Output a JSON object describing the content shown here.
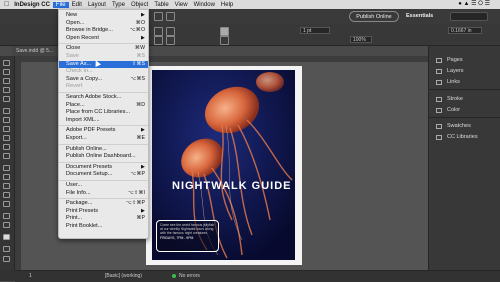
{
  "menubar": {
    "apple": "",
    "app": "InDesign CC",
    "items": [
      "File",
      "Edit",
      "Layout",
      "Type",
      "Object",
      "Table",
      "View",
      "Window",
      "Help"
    ],
    "right_icons": "● ▲ ☰ ⭘ ☰"
  },
  "toolbar": {
    "publish_label": "Publish Online",
    "workspace": "Essentials",
    "stroke_weight": "1 pt",
    "zoom": "100%",
    "dimension": "0.1667 in"
  },
  "document": {
    "tab_title": "Save.indd @ 5..."
  },
  "file_menu": {
    "items": [
      {
        "label": "New",
        "shortcut": "▶",
        "state": "normal"
      },
      {
        "label": "Open...",
        "shortcut": "⌘O",
        "state": "normal"
      },
      {
        "label": "Browse in Bridge...",
        "shortcut": "⌥⌘O",
        "state": "normal"
      },
      {
        "label": "Open Recent",
        "shortcut": "▶",
        "state": "normal"
      },
      {
        "sep": true
      },
      {
        "label": "Close",
        "shortcut": "⌘W",
        "state": "normal"
      },
      {
        "label": "Save",
        "shortcut": "⌘S",
        "state": "disabled"
      },
      {
        "label": "Save As...",
        "shortcut": "⇧⌘S",
        "state": "highlighted"
      },
      {
        "label": "Check In...",
        "shortcut": "",
        "state": "disabled"
      },
      {
        "label": "Save a Copy...",
        "shortcut": "⌥⌘S",
        "state": "normal"
      },
      {
        "label": "Revert",
        "shortcut": "",
        "state": "disabled"
      },
      {
        "sep": true
      },
      {
        "label": "Search Adobe Stock...",
        "shortcut": "",
        "state": "normal"
      },
      {
        "label": "Place...",
        "shortcut": "⌘D",
        "state": "normal"
      },
      {
        "label": "Place from CC Libraries...",
        "shortcut": "",
        "state": "normal"
      },
      {
        "label": "Import XML...",
        "shortcut": "",
        "state": "normal"
      },
      {
        "sep": true
      },
      {
        "label": "Adobe PDF Presets",
        "shortcut": "▶",
        "state": "normal"
      },
      {
        "label": "Export...",
        "shortcut": "⌘E",
        "state": "normal"
      },
      {
        "sep": true
      },
      {
        "label": "Publish Online...",
        "shortcut": "",
        "state": "normal"
      },
      {
        "label": "Publish Online Dashboard...",
        "shortcut": "",
        "state": "normal"
      },
      {
        "sep": true
      },
      {
        "label": "Document Presets",
        "shortcut": "▶",
        "state": "normal"
      },
      {
        "label": "Document Setup...",
        "shortcut": "⌥⌘P",
        "state": "normal"
      },
      {
        "sep": true
      },
      {
        "label": "User...",
        "shortcut": "",
        "state": "normal"
      },
      {
        "label": "File Info...",
        "shortcut": "⌥⇧⌘I",
        "state": "normal"
      },
      {
        "sep": true
      },
      {
        "label": "Package...",
        "shortcut": "⌥⇧⌘P",
        "state": "normal"
      },
      {
        "label": "Print Presets",
        "shortcut": "▶",
        "state": "normal"
      },
      {
        "label": "Print...",
        "shortcut": "⌘P",
        "state": "normal"
      },
      {
        "label": "Print Booklet...",
        "shortcut": "",
        "state": "normal"
      }
    ]
  },
  "page": {
    "title": "NIGHTWALK GUIDE",
    "callout_text": "Come see the world famous jellyfish at our weekly Nightwalk tours along with the famous night creatures",
    "callout_date": "FRIDAYS, 7PM - 9PM"
  },
  "right_panel": {
    "group1": [
      "Pages",
      "Layers",
      "Links"
    ],
    "group2": [
      "Stroke",
      "Color"
    ],
    "group3": [
      "Swatches",
      "CC Libraries"
    ]
  },
  "status": {
    "zoom": "1",
    "profile": "[Basic] (working)",
    "errors": "No errors"
  },
  "colors": {
    "highlight": "#2a6ed8",
    "page_bg": "#0b1140",
    "jelly": "#e0764a"
  }
}
